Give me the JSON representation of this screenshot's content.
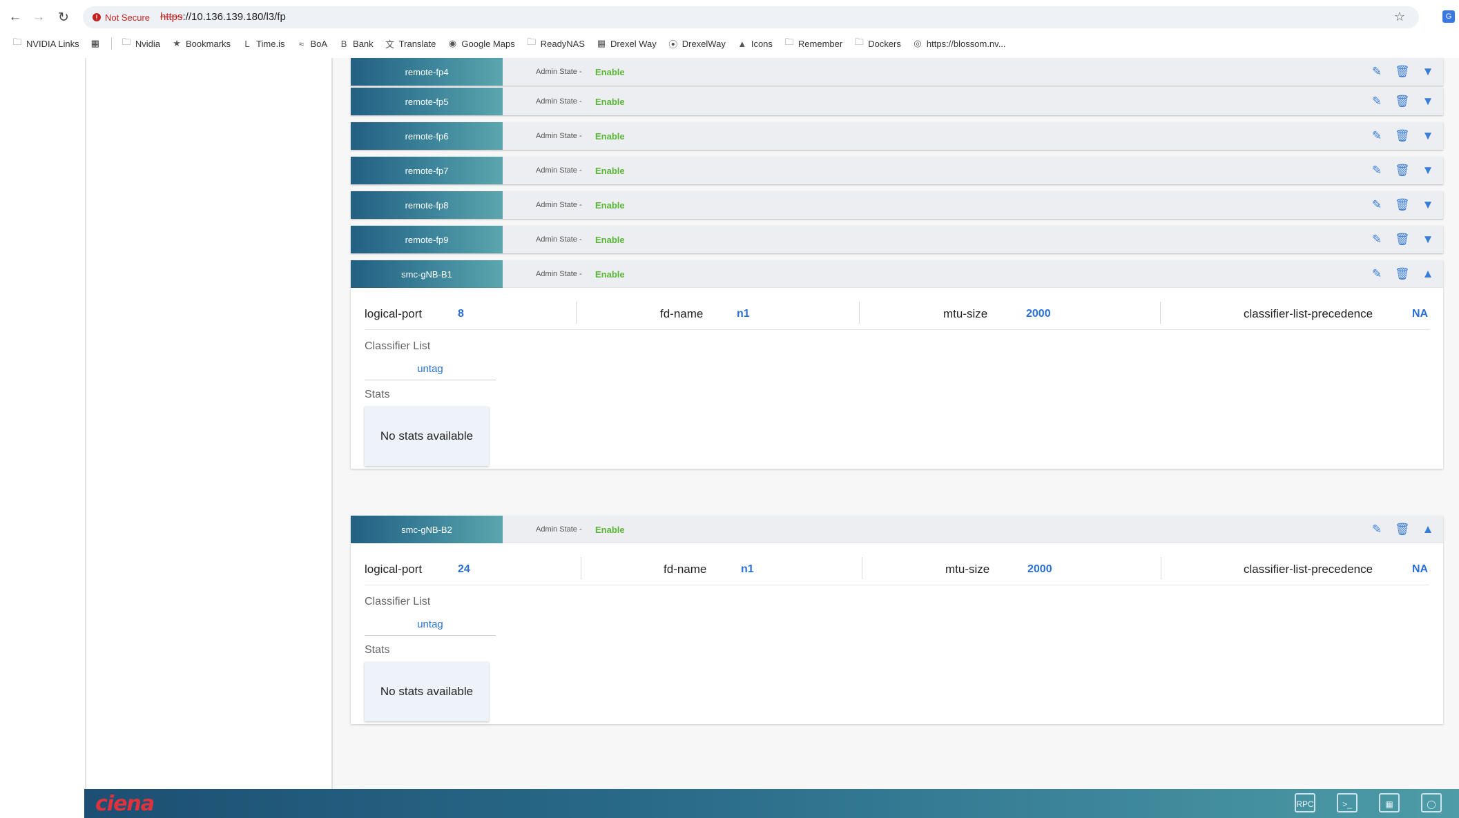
{
  "browser": {
    "security_label": "Not Secure",
    "url_scheme": "https",
    "url_rest": "://10.136.139.180/l3/fp",
    "bookmarks": [
      {
        "label": "NVIDIA Links",
        "icon": "folder-icon"
      },
      {
        "label": "Nvidia",
        "icon": "folder-icon"
      },
      {
        "label": "Bookmarks",
        "icon": "star-icon"
      },
      {
        "label": "Time.is",
        "icon": "timeis-icon"
      },
      {
        "label": "BoA",
        "icon": "boa-icon"
      },
      {
        "label": "Bank",
        "icon": "bank-icon"
      },
      {
        "label": "Translate",
        "icon": "translate-icon"
      },
      {
        "label": "Google Maps",
        "icon": "map-pin-icon"
      },
      {
        "label": "ReadyNAS",
        "icon": "folder-icon"
      },
      {
        "label": "Drexel Way",
        "icon": "drexel-icon"
      },
      {
        "label": "DrexelWay",
        "icon": "wireless-icon"
      },
      {
        "label": "Icons",
        "icon": "icons-icon"
      },
      {
        "label": "Remember",
        "icon": "folder-icon"
      },
      {
        "label": "Dockers",
        "icon": "folder-icon"
      },
      {
        "label": "https://blossom.nv...",
        "icon": "globe-icon"
      }
    ]
  },
  "fp_list": {
    "admin_label": "Admin State -",
    "rows": [
      {
        "name": "remote-fp4",
        "state": "Enable"
      },
      {
        "name": "remote-fp5",
        "state": "Enable"
      },
      {
        "name": "remote-fp6",
        "state": "Enable"
      },
      {
        "name": "remote-fp7",
        "state": "Enable"
      },
      {
        "name": "remote-fp8",
        "state": "Enable"
      },
      {
        "name": "remote-fp9",
        "state": "Enable"
      },
      {
        "name": "smc-gNB-B1",
        "state": "Enable"
      },
      {
        "name": "smc-gNB-B2",
        "state": "Enable"
      }
    ]
  },
  "details": [
    {
      "fp": "smc-gNB-B1",
      "logical_port_label": "logical-port",
      "logical_port": "8",
      "fd_name_label": "fd-name",
      "fd_name": "n1",
      "mtu_label": "mtu-size",
      "mtu": "2000",
      "precedence_label": "classifier-list-precedence",
      "precedence": "NA",
      "classifier_list_label": "Classifier List",
      "classifiers": [
        "untag"
      ],
      "stats_label": "Stats",
      "stats_text": "No stats available"
    },
    {
      "fp": "smc-gNB-B2",
      "logical_port_label": "logical-port",
      "logical_port": "24",
      "fd_name_label": "fd-name",
      "fd_name": "n1",
      "mtu_label": "mtu-size",
      "mtu": "2000",
      "precedence_label": "classifier-list-precedence",
      "precedence": "NA",
      "classifier_list_label": "Classifier List",
      "classifiers": [
        "untag"
      ],
      "stats_label": "Stats",
      "stats_text": "No stats available"
    }
  ],
  "footer": {
    "logo": "ciena",
    "icons": [
      {
        "name": "rpc-icon",
        "label": "RPC"
      },
      {
        "name": "terminal-icon",
        "label": ">_"
      },
      {
        "name": "image-edit-icon",
        "label": ""
      },
      {
        "name": "support-icon",
        "label": ""
      }
    ]
  },
  "colors": {
    "accent_blue": "#2a6fd6",
    "enable_green": "#59b635",
    "header_gradient_start": "#235f82",
    "header_gradient_end": "#5ba6ae",
    "logo_red": "#e0323c"
  }
}
